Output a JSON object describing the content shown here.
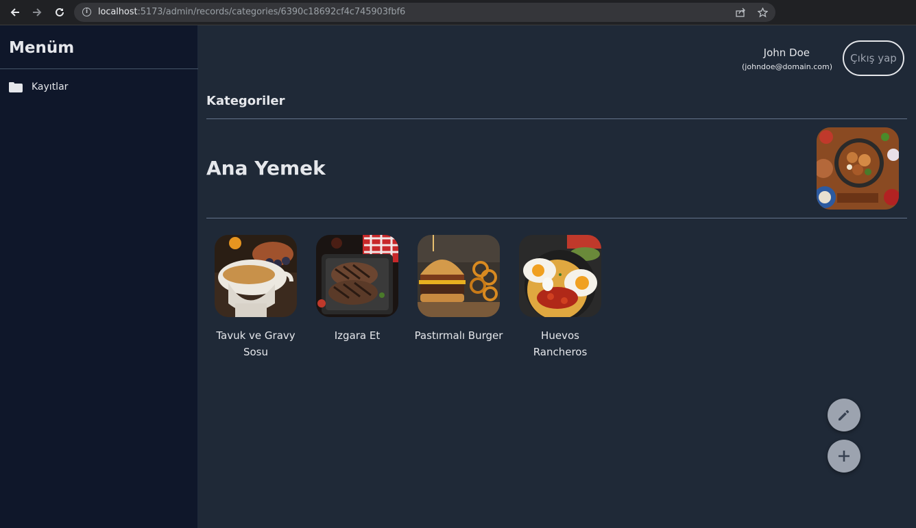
{
  "browser": {
    "url_host": "localhost",
    "url_rest": ":5173/admin/records/categories/6390c18692cf4c745903fbf6"
  },
  "sidebar": {
    "title": "Menüm",
    "items": [
      {
        "label": "Kayıtlar",
        "icon": "folder-icon"
      }
    ]
  },
  "user": {
    "name": "John Doe",
    "email": "(johndoe@domain.com)",
    "logout_label": "Çıkış yap"
  },
  "page": {
    "section_title": "Kategoriler",
    "category_name": "Ana Yemek"
  },
  "products": [
    {
      "name": "Tavuk ve Gravy Sosu"
    },
    {
      "name": "Izgara Et"
    },
    {
      "name": "Pastırmalı Burger"
    },
    {
      "name": "Huevos Rancheros"
    }
  ],
  "actions": {
    "edit_icon": "pencil-icon",
    "add_icon": "plus-icon"
  },
  "colors": {
    "background": "#1f2937",
    "sidebar": "#0f172a",
    "fab": "#9ca3af"
  }
}
